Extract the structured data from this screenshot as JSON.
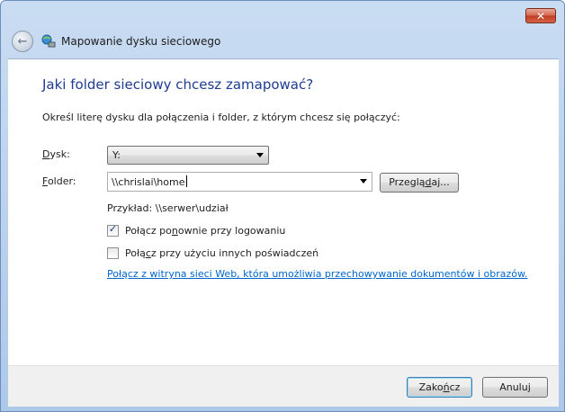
{
  "window": {
    "title": "Mapowanie dysku sieciowego",
    "close_glyph": "✕"
  },
  "header": {
    "back_icon": "back-arrow-icon",
    "title_icon": "network-drive-icon"
  },
  "main": {
    "heading": "Jaki folder sieciowy chcesz zamapować?",
    "description": "Określ literę dysku dla połączenia i folder, z którym chcesz się połączyć:",
    "drive": {
      "label_accel": "D",
      "label_rest": "ysk:",
      "value": "Y:"
    },
    "folder": {
      "label_accel": "F",
      "label_rest": "older:",
      "value": "\\\\chrislai\\home"
    },
    "browse_button": {
      "pre": "Przeglą",
      "accel": "d",
      "post": "aj..."
    },
    "example": "Przykład: \\\\serwer\\udział",
    "reconnect": {
      "pre": "Połącz po",
      "accel": "n",
      "post": "ownie przy logowaniu",
      "checked": true
    },
    "other_credentials": {
      "pre": "Połą",
      "accel": "c",
      "post": "z przy użyciu innych poświadczeń",
      "checked": false
    },
    "link": "Połącz z witryna sieci Web, która umożliwia przechowywanie dokumentów i obrazów."
  },
  "footer": {
    "finish_button": {
      "pre": "Zako",
      "accel": "ń",
      "post": "cz"
    },
    "cancel_button": "Anuluj"
  },
  "colors": {
    "heading": "#1f3c92",
    "link": "#0066cc",
    "close": "#c1391f"
  }
}
